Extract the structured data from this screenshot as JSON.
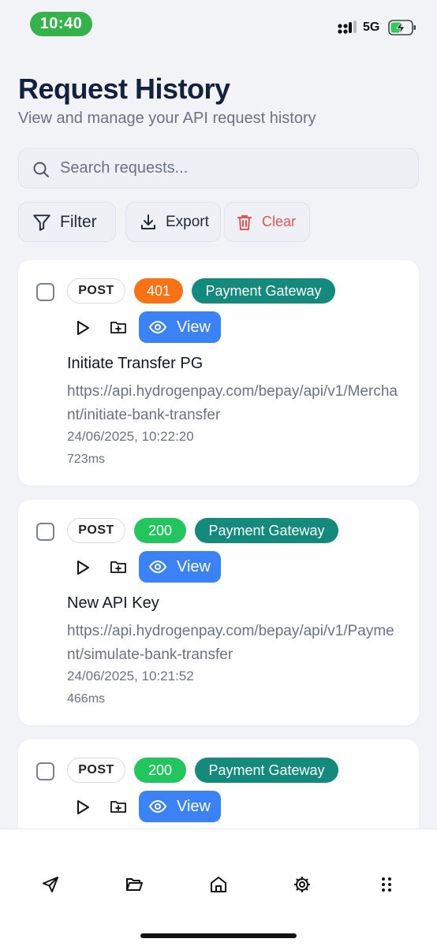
{
  "status_bar": {
    "time": "10:40",
    "network": "5G"
  },
  "header": {
    "title": "Request History",
    "subtitle": "View and manage your API request history"
  },
  "search": {
    "placeholder": "Search requests..."
  },
  "toolbar": {
    "filter_label": "Filter",
    "export_label": "Export",
    "clear_label": "Clear"
  },
  "requests": [
    {
      "method": "POST",
      "status": "401",
      "status_color": "#f97316",
      "category": "Payment Gateway",
      "view_label": "View",
      "name": "Initiate Transfer PG",
      "url": "https://api.hydrogenpay.com/bepay/api/v1/Merchant/initiate-bank-transfer",
      "timestamp": "24/06/2025, 10:22:20",
      "duration": "723ms"
    },
    {
      "method": "POST",
      "status": "200",
      "status_color": "#22c55e",
      "category": "Payment Gateway",
      "view_label": "View",
      "name": "New API Key",
      "url": "https://api.hydrogenpay.com/bepay/api/v1/Payment/simulate-bank-transfer",
      "timestamp": "24/06/2025, 10:21:52",
      "duration": "466ms"
    },
    {
      "method": "POST",
      "status": "200",
      "status_color": "#22c55e",
      "category": "Payment Gateway",
      "view_label": "View"
    }
  ],
  "bottom_nav": {
    "items": [
      "send-icon",
      "folder-open-icon",
      "home-icon",
      "settings-icon",
      "more-grid-icon"
    ]
  }
}
